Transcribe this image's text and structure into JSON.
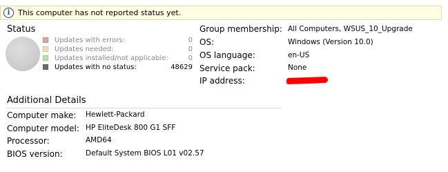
{
  "banner": {
    "text": "This computer has not reported status yet."
  },
  "status": {
    "title": "Status",
    "legend": [
      {
        "label": "Updates with errors:",
        "count": "0",
        "color": "#e0a3a3"
      },
      {
        "label": "Updates needed:",
        "count": "0",
        "color": "#f3e2ad"
      },
      {
        "label": "Updates installed/not applicable:",
        "count": "0",
        "color": "#b7e3a6"
      },
      {
        "label": "Updates with no status:",
        "count": "48629",
        "color": "#6b6b6b"
      }
    ]
  },
  "info": [
    {
      "label": "Group membership:",
      "value": "All Computers, WSUS_10_Upgrade"
    },
    {
      "label": "OS:",
      "value": "Windows (Version 10.0)"
    },
    {
      "label": "OS language:",
      "value": "en-US"
    },
    {
      "label": "Service pack:",
      "value": "None"
    },
    {
      "label": "IP address:",
      "value": ""
    }
  ],
  "additional": {
    "title": "Additional Details",
    "rows": [
      {
        "label": "Computer make:",
        "value": "Hewlett-Packard"
      },
      {
        "label": "Computer model:",
        "value": "HP EliteDesk 800 G1 SFF"
      },
      {
        "label": "Processor:",
        "value": "AMD64"
      },
      {
        "label": "BIOS version:",
        "value": "Default System BIOS L01 v02.57"
      }
    ]
  },
  "colors": {
    "banner_bg": "#ffffe1",
    "redaction": "#ff0000"
  }
}
